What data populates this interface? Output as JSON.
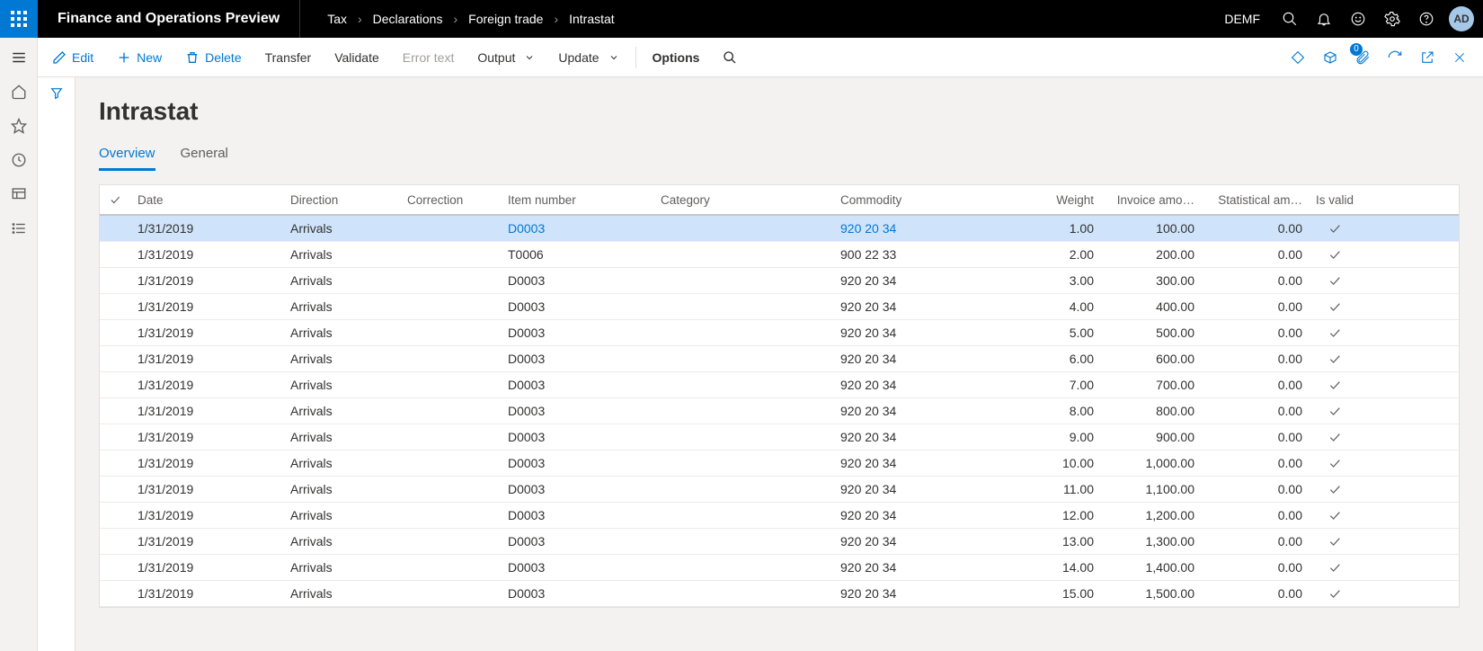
{
  "header": {
    "app_title": "Finance and Operations Preview",
    "breadcrumb": [
      "Tax",
      "Declarations",
      "Foreign trade",
      "Intrastat"
    ],
    "company": "DEMF",
    "avatar": "AD"
  },
  "actions": {
    "edit": "Edit",
    "new": "New",
    "delete": "Delete",
    "transfer": "Transfer",
    "validate": "Validate",
    "error_text": "Error text",
    "output": "Output",
    "update": "Update",
    "options": "Options",
    "badge_count": "0"
  },
  "page": {
    "title": "Intrastat",
    "tabs": {
      "overview": "Overview",
      "general": "General"
    }
  },
  "grid": {
    "columns": {
      "date": "Date",
      "direction": "Direction",
      "correction": "Correction",
      "item": "Item number",
      "category": "Category",
      "commodity": "Commodity",
      "weight": "Weight",
      "invoice": "Invoice amo…",
      "statistical": "Statistical am…",
      "valid": "Is valid"
    },
    "rows": [
      {
        "date": "1/31/2019",
        "direction": "Arrivals",
        "correction": "",
        "item": "D0003",
        "category": "",
        "commodity": "920 20 34",
        "weight": "1.00",
        "invoice": "100.00",
        "statistical": "0.00",
        "valid": true,
        "selected": true
      },
      {
        "date": "1/31/2019",
        "direction": "Arrivals",
        "correction": "",
        "item": "T0006",
        "category": "",
        "commodity": "900 22 33",
        "weight": "2.00",
        "invoice": "200.00",
        "statistical": "0.00",
        "valid": true
      },
      {
        "date": "1/31/2019",
        "direction": "Arrivals",
        "correction": "",
        "item": "D0003",
        "category": "",
        "commodity": "920 20 34",
        "weight": "3.00",
        "invoice": "300.00",
        "statistical": "0.00",
        "valid": true
      },
      {
        "date": "1/31/2019",
        "direction": "Arrivals",
        "correction": "",
        "item": "D0003",
        "category": "",
        "commodity": "920 20 34",
        "weight": "4.00",
        "invoice": "400.00",
        "statistical": "0.00",
        "valid": true
      },
      {
        "date": "1/31/2019",
        "direction": "Arrivals",
        "correction": "",
        "item": "D0003",
        "category": "",
        "commodity": "920 20 34",
        "weight": "5.00",
        "invoice": "500.00",
        "statistical": "0.00",
        "valid": true
      },
      {
        "date": "1/31/2019",
        "direction": "Arrivals",
        "correction": "",
        "item": "D0003",
        "category": "",
        "commodity": "920 20 34",
        "weight": "6.00",
        "invoice": "600.00",
        "statistical": "0.00",
        "valid": true
      },
      {
        "date": "1/31/2019",
        "direction": "Arrivals",
        "correction": "",
        "item": "D0003",
        "category": "",
        "commodity": "920 20 34",
        "weight": "7.00",
        "invoice": "700.00",
        "statistical": "0.00",
        "valid": true
      },
      {
        "date": "1/31/2019",
        "direction": "Arrivals",
        "correction": "",
        "item": "D0003",
        "category": "",
        "commodity": "920 20 34",
        "weight": "8.00",
        "invoice": "800.00",
        "statistical": "0.00",
        "valid": true
      },
      {
        "date": "1/31/2019",
        "direction": "Arrivals",
        "correction": "",
        "item": "D0003",
        "category": "",
        "commodity": "920 20 34",
        "weight": "9.00",
        "invoice": "900.00",
        "statistical": "0.00",
        "valid": true
      },
      {
        "date": "1/31/2019",
        "direction": "Arrivals",
        "correction": "",
        "item": "D0003",
        "category": "",
        "commodity": "920 20 34",
        "weight": "10.00",
        "invoice": "1,000.00",
        "statistical": "0.00",
        "valid": true
      },
      {
        "date": "1/31/2019",
        "direction": "Arrivals",
        "correction": "",
        "item": "D0003",
        "category": "",
        "commodity": "920 20 34",
        "weight": "11.00",
        "invoice": "1,100.00",
        "statistical": "0.00",
        "valid": true
      },
      {
        "date": "1/31/2019",
        "direction": "Arrivals",
        "correction": "",
        "item": "D0003",
        "category": "",
        "commodity": "920 20 34",
        "weight": "12.00",
        "invoice": "1,200.00",
        "statistical": "0.00",
        "valid": true
      },
      {
        "date": "1/31/2019",
        "direction": "Arrivals",
        "correction": "",
        "item": "D0003",
        "category": "",
        "commodity": "920 20 34",
        "weight": "13.00",
        "invoice": "1,300.00",
        "statistical": "0.00",
        "valid": true
      },
      {
        "date": "1/31/2019",
        "direction": "Arrivals",
        "correction": "",
        "item": "D0003",
        "category": "",
        "commodity": "920 20 34",
        "weight": "14.00",
        "invoice": "1,400.00",
        "statistical": "0.00",
        "valid": true
      },
      {
        "date": "1/31/2019",
        "direction": "Arrivals",
        "correction": "",
        "item": "D0003",
        "category": "",
        "commodity": "920 20 34",
        "weight": "15.00",
        "invoice": "1,500.00",
        "statistical": "0.00",
        "valid": true
      }
    ]
  }
}
